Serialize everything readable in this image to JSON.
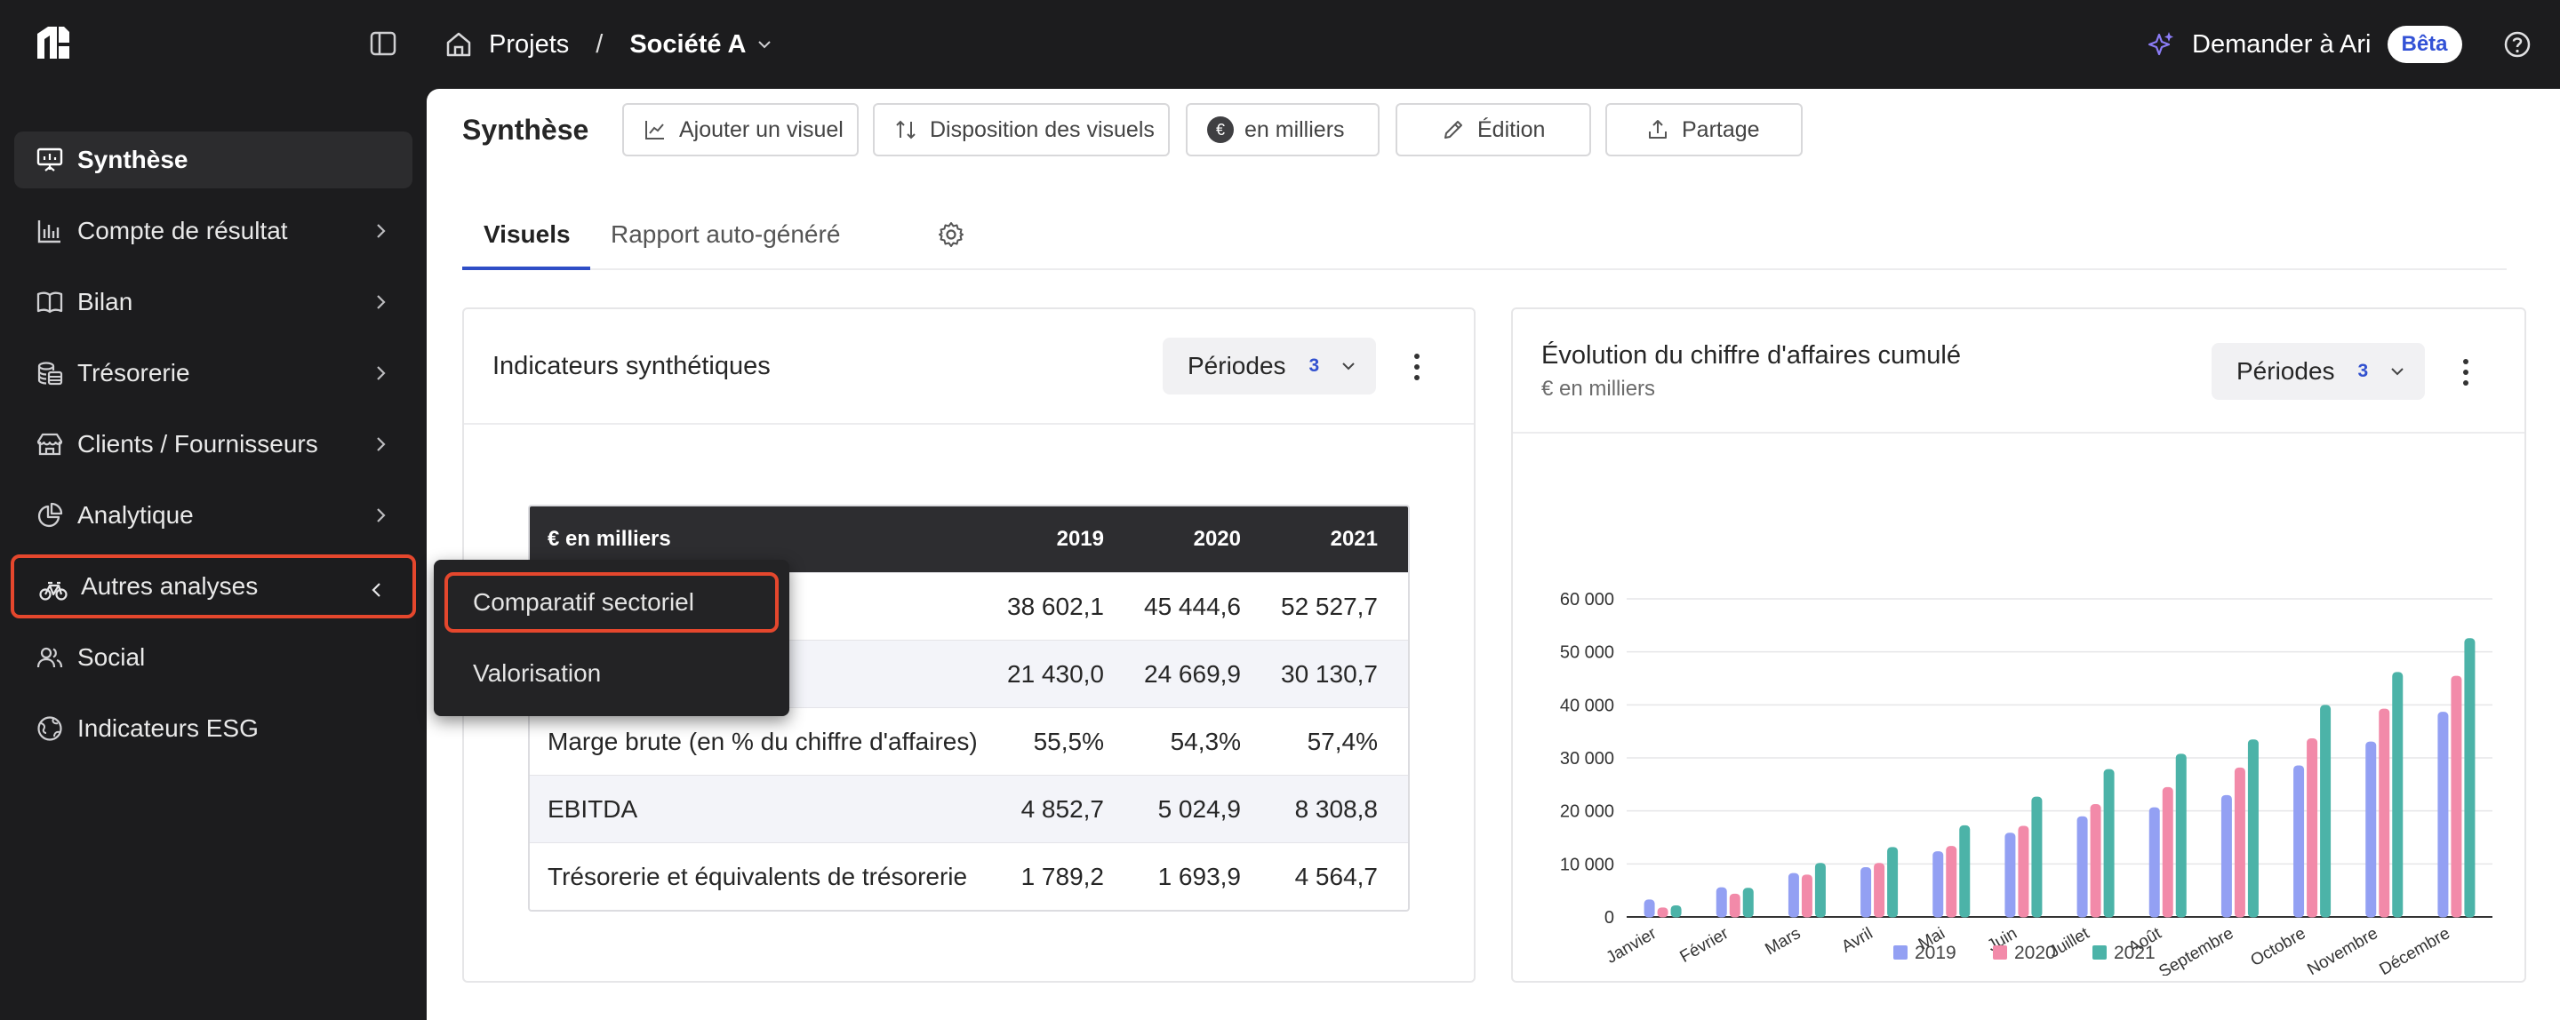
{
  "header": {
    "breadcrumb_root": "Projets",
    "breadcrumb_sep": "/",
    "company": "Société A",
    "ask_label": "Demander à Ari",
    "beta_badge": "Bêta"
  },
  "sidebar": {
    "items": [
      {
        "label": "Synthèse",
        "icon": "presentation-icon"
      },
      {
        "label": "Compte de résultat",
        "icon": "bar-chart-icon"
      },
      {
        "label": "Bilan",
        "icon": "book-icon"
      },
      {
        "label": "Trésorerie",
        "icon": "coins-icon"
      },
      {
        "label": "Clients / Fournisseurs",
        "icon": "store-icon"
      },
      {
        "label": "Analytique",
        "icon": "pie-chart-icon"
      },
      {
        "label": "Autres analyses",
        "icon": "bicycle-icon"
      },
      {
        "label": "Social",
        "icon": "users-icon"
      },
      {
        "label": "Indicateurs ESG",
        "icon": "globe-leaf-icon"
      }
    ],
    "submenu": [
      {
        "label": "Comparatif sectoriel"
      },
      {
        "label": "Valorisation"
      }
    ]
  },
  "page": {
    "title": "Synthèse",
    "toolbar": {
      "add_visual": "Ajouter un visuel",
      "layout": "Disposition des visuels",
      "currency_symbol": "€",
      "unit": "en milliers",
      "edit": "Édition",
      "share": "Partage"
    },
    "tabs": [
      {
        "label": "Visuels"
      },
      {
        "label": "Rapport auto-généré"
      }
    ]
  },
  "card_indicators": {
    "title": "Indicateurs synthétiques",
    "periods_label": "Périodes",
    "periods_count": "3",
    "table": {
      "headers": [
        "€ en milliers",
        "2019",
        "2020",
        "2021"
      ],
      "rows": [
        [
          "",
          "38 602,1",
          "45 444,6",
          "52 527,7"
        ],
        [
          "",
          "21 430,0",
          "24 669,9",
          "30 130,7"
        ],
        [
          "Marge brute (en % du chiffre d'affaires)",
          "55,5%",
          "54,3%",
          "57,4%"
        ],
        [
          "EBITDA",
          "4 852,7",
          "5 024,9",
          "8 308,8"
        ],
        [
          "Trésorerie et équivalents de trésorerie",
          "1 789,2",
          "1 693,9",
          "4 564,7"
        ]
      ]
    }
  },
  "card_chart": {
    "title": "Évolution du chiffre d'affaires cumulé",
    "subtitle": "€ en milliers",
    "periods_label": "Périodes",
    "periods_count": "3"
  },
  "chart_data": {
    "type": "bar",
    "title": "Évolution du chiffre d'affaires cumulé",
    "ylabel": "",
    "xlabel": "",
    "ylim": [
      0,
      60000
    ],
    "yticks": [
      0,
      10000,
      20000,
      30000,
      40000,
      50000,
      60000
    ],
    "ytick_labels": [
      "0",
      "10 000",
      "20 000",
      "30 000",
      "40 000",
      "50 000",
      "60 000"
    ],
    "grid": true,
    "legend": "bottom",
    "categories": [
      "Janvier",
      "Février",
      "Mars",
      "Avril",
      "Mai",
      "Juin",
      "Juillet",
      "Août",
      "Septembre",
      "Octobre",
      "Novembre",
      "Décembre"
    ],
    "series": [
      {
        "name": "2019",
        "color": "#93a0f3",
        "values": [
          3200,
          5500,
          8200,
          9300,
          12300,
          15800,
          18900,
          20600,
          22900,
          28500,
          33000,
          38600
        ]
      },
      {
        "name": "2020",
        "color": "#f28aa9",
        "values": [
          1700,
          4300,
          7900,
          10100,
          13300,
          17100,
          21200,
          24400,
          28100,
          33600,
          39200,
          45400
        ]
      },
      {
        "name": "2021",
        "color": "#4cb3a8",
        "values": [
          2100,
          5400,
          10100,
          13100,
          17200,
          22600,
          27800,
          30700,
          33400,
          39900,
          46100,
          52500
        ]
      }
    ]
  },
  "colors": {
    "sidebar_bg": "#1c1c1e",
    "accent": "#2f4ec6",
    "highlight": "#e5472d"
  }
}
